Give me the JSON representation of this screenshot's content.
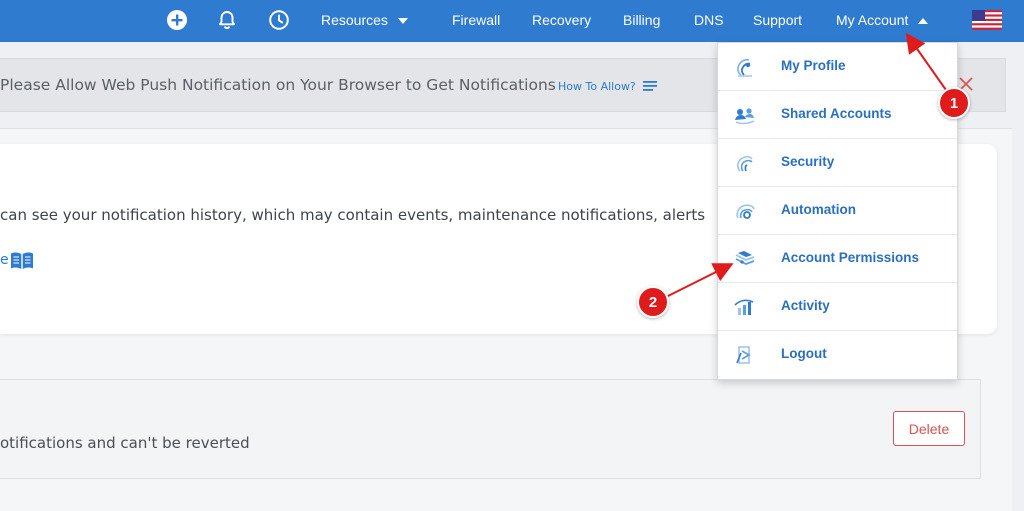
{
  "nav": {
    "add_icon": "plus-circle-icon",
    "bell_icon": "bell-icon",
    "clock_icon": "clock-icon",
    "resources": "Resources",
    "firewall": "Firewall",
    "recovery": "Recovery",
    "billing": "Billing",
    "dns": "DNS",
    "support": "Support",
    "my_account": "My Account",
    "flag_icon": "us-flag-icon",
    "bar_color": "#2e7bd0"
  },
  "banner": {
    "text": "Please Allow Web Push Notification on Your Browser to Get Notifications",
    "howto": "How To Allow?",
    "close_icon": "close-icon"
  },
  "notification_card": {
    "text": "can see your notification history, which may contain events, maintenance notifications, alerts",
    "link_fragment": "e",
    "book_icon": "book-icon"
  },
  "delete_card": {
    "text": "otifications and can't be reverted",
    "delete_label": "Delete"
  },
  "dropdown": {
    "items": [
      {
        "label": "My Profile",
        "icon": "profile-icon"
      },
      {
        "label": "Shared Accounts",
        "icon": "shared-accounts-icon"
      },
      {
        "label": "Security",
        "icon": "security-icon"
      },
      {
        "label": "Automation",
        "icon": "automation-icon"
      },
      {
        "label": "Account Permissions",
        "icon": "permissions-icon"
      },
      {
        "label": "Activity",
        "icon": "activity-icon"
      },
      {
        "label": "Logout",
        "icon": "logout-icon"
      }
    ]
  },
  "annotations": {
    "marker1": "1",
    "marker2": "2",
    "color": "#e01b1b"
  }
}
